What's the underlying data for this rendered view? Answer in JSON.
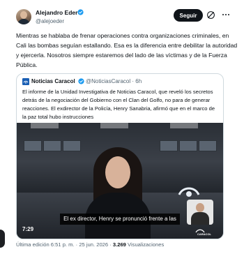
{
  "author": {
    "name": "Alejandro Eder",
    "handle": "@alejoeder"
  },
  "actions": {
    "follow_label": "Seguir"
  },
  "tweet": {
    "text": "Mientras se hablaba de frenar operaciones contra organizaciones criminales, en Cali las bombas seguían estallando. Esa es la diferencia entre debilitar la autoridad y ejercerla. Nosotros siempre estaremos del lado de las víctimas y de la Fuerza Pública."
  },
  "quoted": {
    "name": "Noticias Caracol",
    "handle": "@NoticiasCaracol",
    "separator": "·",
    "age": "6h",
    "text": "El informe de la Unidad Investigativa de Noticias Caracol, que reveló los secretos detrás de la negociación del Gobierno con el Clan del Golfo, no para de generar reacciones. El exdirector de la Policía, Henry Sanabria, afirmó que en el marco de la paz total hubo instrucciones",
    "video": {
      "caption": "El ex director, Henry se pronunció frente a las",
      "duration": "7:29",
      "watermark": "CARACOL"
    }
  },
  "footer": {
    "edited": "Última edición 6:51 p. m. · 25 jun. 2026 ·",
    "views": "3.269",
    "views_label": "Visualizaciones"
  },
  "colors": {
    "verified": "#1d9bf0",
    "text": "#0f1419",
    "secondary": "#536471",
    "border": "#cfd9de",
    "caracol_blue": "#1a5fb4"
  },
  "icons": [
    "verified-badge-icon",
    "grok-icon",
    "more-options-icon",
    "caracol-logo-icon"
  ]
}
